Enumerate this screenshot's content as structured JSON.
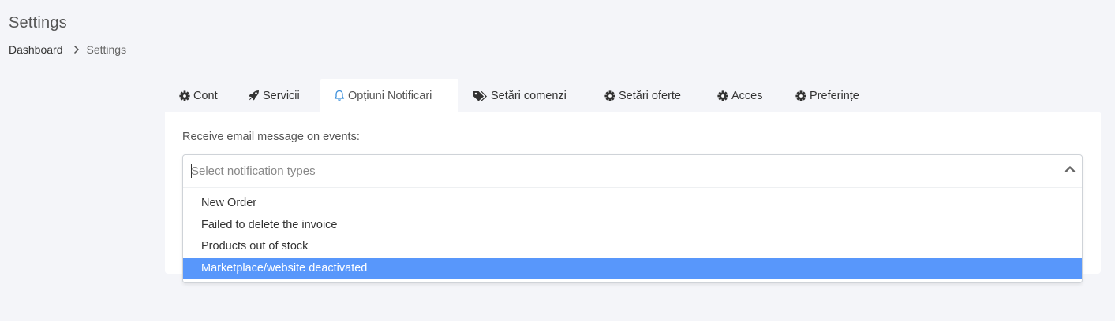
{
  "header": {
    "title": "Settings"
  },
  "breadcrumb": {
    "home": "Dashboard",
    "current": "Settings"
  },
  "tabs": [
    {
      "label": "Cont",
      "icon": "gear-icon"
    },
    {
      "label": "Servicii",
      "icon": "rocket-icon"
    },
    {
      "label": "Opțiuni Notificari",
      "icon": "bell-icon",
      "active": true
    },
    {
      "label": "Setări comenzi",
      "icon": "tags-icon"
    },
    {
      "label": "Setări oferte",
      "icon": "gear-icon"
    },
    {
      "label": "Acces",
      "icon": "gear-icon"
    },
    {
      "label": "Preferințe",
      "icon": "gear-icon"
    }
  ],
  "form": {
    "label": "Receive email message on events:",
    "placeholder": "Select notification types",
    "value": "",
    "dropdown_icon": "chevron-up-icon",
    "options": [
      {
        "label": "New Order"
      },
      {
        "label": "Failed to delete the invoice"
      },
      {
        "label": "Products out of stock"
      },
      {
        "label": "Marketplace/website deactivated",
        "highlighted": true
      }
    ]
  },
  "colors": {
    "accent": "#5897fb",
    "bell": "#3b8fdb",
    "background": "#f4f5f9"
  }
}
